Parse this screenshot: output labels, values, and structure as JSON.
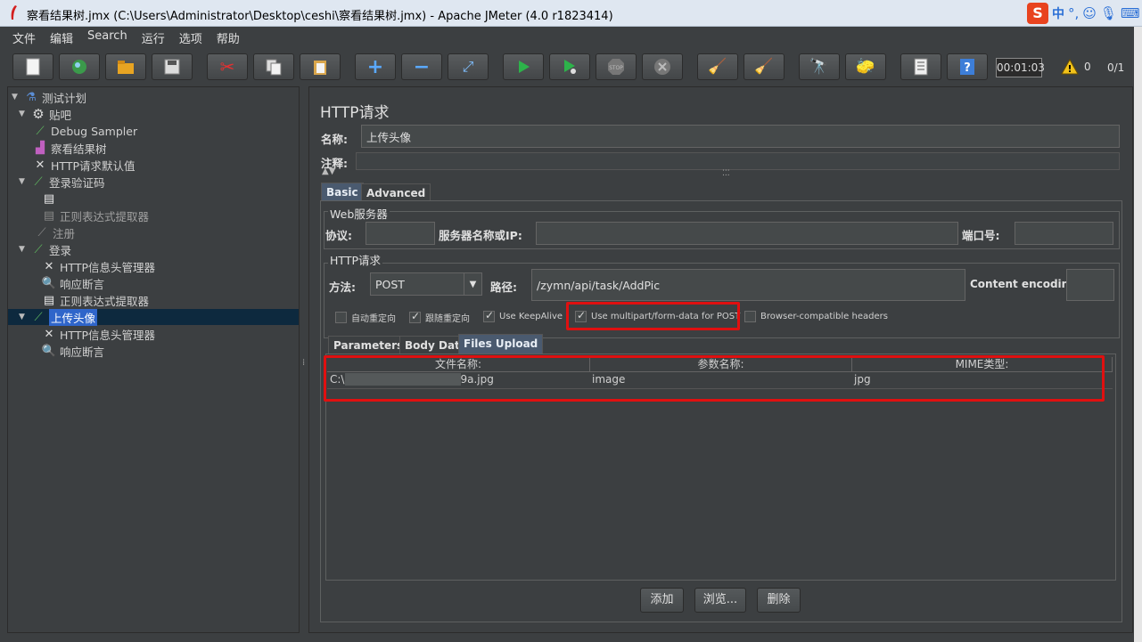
{
  "window": {
    "title": "察看结果树.jmx (C:\\Users\\Administrator\\Desktop\\ceshi\\察看结果树.jmx) - Apache JMeter (4.0 r1823414)",
    "ime": {
      "logo": "S",
      "mode": "中",
      "punct": "°,"
    }
  },
  "menu": [
    "文件",
    "编辑",
    "Search",
    "运行",
    "选项",
    "帮助"
  ],
  "toolbar": {
    "buttons": [
      "new-icon",
      "templates-icon",
      "open-icon",
      "save-icon",
      "cut-icon",
      "copy-icon",
      "paste-icon",
      "expand-icon",
      "collapse-icon",
      "toggle-icon",
      "start-icon",
      "start-no-pause-icon",
      "stop-icon",
      "shutdown-icon",
      "clear-icon",
      "clear-all-icon",
      "search-icon",
      "reset-search-icon",
      "function-helper-icon",
      "help-icon"
    ],
    "timer": "00:01:03",
    "warning_count": "0",
    "threads": "0/1"
  },
  "tree": [
    {
      "label": "测试计划",
      "icon": "flask-icon",
      "toggle": "▼"
    },
    {
      "label": "贴吧",
      "icon": "gear-icon",
      "toggle": "▼"
    },
    {
      "label": "Debug Sampler",
      "icon": "pipette-icon",
      "toggle": ""
    },
    {
      "label": "察看结果树",
      "icon": "chart-icon",
      "toggle": ""
    },
    {
      "label": "HTTP请求默认值",
      "icon": "wrench-icon",
      "toggle": ""
    },
    {
      "label": "登录验证码",
      "icon": "pipette-icon",
      "toggle": "▼"
    },
    {
      "label": "",
      "icon": "extractor-icon",
      "toggle": ""
    },
    {
      "label": "正则表达式提取器",
      "icon": "extractor-disabled-icon",
      "toggle": ""
    },
    {
      "label": "注册",
      "icon": "pipette-disabled-icon",
      "toggle": ""
    },
    {
      "label": "登录",
      "icon": "pipette-icon",
      "toggle": "▼"
    },
    {
      "label": "HTTP信息头管理器",
      "icon": "wrench-icon",
      "toggle": ""
    },
    {
      "label": "响应断言",
      "icon": "magnifier-icon",
      "toggle": ""
    },
    {
      "label": "正则表达式提取器",
      "icon": "extractor-icon",
      "toggle": ""
    },
    {
      "label": "上传头像",
      "icon": "pipette-icon",
      "toggle": "▼"
    },
    {
      "label": "HTTP信息头管理器",
      "icon": "wrench-icon",
      "toggle": ""
    },
    {
      "label": "响应断言",
      "icon": "magnifier-icon",
      "toggle": ""
    }
  ],
  "panel": {
    "title": "HTTP请求",
    "name_label": "名称:",
    "name_value": "上传头像",
    "comment_label": "注释:",
    "tabs": [
      "Basic",
      "Advanced"
    ],
    "web_server": {
      "group_label": "Web服务器",
      "protocol_label": "协议:",
      "server_label": "服务器名称或IP:",
      "port_label": "端口号:",
      "protocol_value": "",
      "server_value": "",
      "port_value": ""
    },
    "http_request": {
      "group_label": "HTTP请求",
      "method_label": "方法:",
      "method_value": "POST",
      "path_label": "路径:",
      "path_value": "/zymn/api/task/AddPic",
      "encoding_label": "Content encoding:",
      "encoding_value": ""
    },
    "checkboxes": [
      {
        "label": "自动重定向",
        "checked": false
      },
      {
        "label": "跟随重定向",
        "checked": true
      },
      {
        "label": "Use KeepAlive",
        "checked": true
      },
      {
        "label": "Use multipart/form-data for POST",
        "checked": true
      },
      {
        "label": "Browser-compatible headers",
        "checked": false
      }
    ],
    "subtabs": [
      "Parameters",
      "Body Data",
      "Files Upload"
    ],
    "files_table": {
      "columns": [
        "文件名称:",
        "参数名称:",
        "MIME类型:"
      ],
      "rows": [
        {
          "file": "C:\\                    ktop\\50573b238a0df9a.jpg",
          "param": "image",
          "mime": "jpg"
        }
      ]
    },
    "buttons": {
      "add": "添加",
      "browse": "浏览...",
      "delete": "删除"
    }
  }
}
